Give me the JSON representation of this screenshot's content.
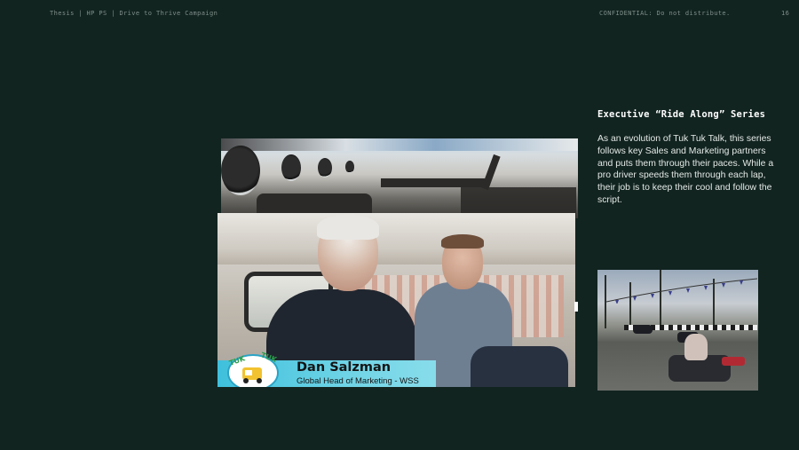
{
  "header": {
    "left": "Thesis | HP PS | Drive to Thrive Campaign",
    "confidential": "CONFIDENTIAL: Do not distribute.",
    "page_number": "16"
  },
  "section": {
    "title": "Executive “Ride Along” Series",
    "body": "As an evolution of Tuk Tuk Talk, this series follows key Sales and Marketing partners and puts them through their paces. While a pro driver speeds them through each lap, their job is to keep their cool and follow the script."
  },
  "video_overlay": {
    "name": "Dan Salzman",
    "role": "Global Head of Marketing - WSS",
    "badge_text": "TUK TUK TALK"
  },
  "colors": {
    "background": "#122420",
    "lower_third": "#4fc6df"
  }
}
